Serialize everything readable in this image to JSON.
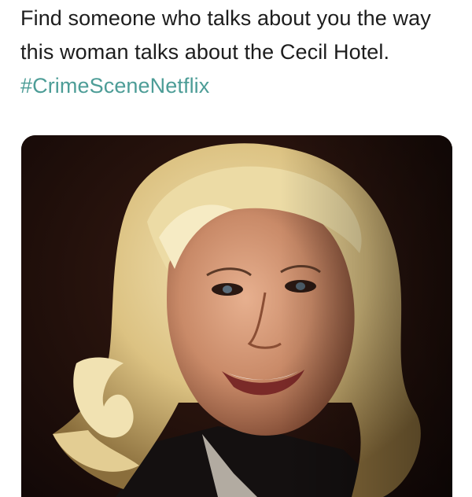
{
  "tweet": {
    "text": "Find someone who talks about you the way this woman talks about the Cecil Hotel.",
    "hashtag": "#CrimeSceneNetflix",
    "hashtag_color": "#4d9d97",
    "text_color": "#1d1d1d"
  },
  "media": {
    "image_type": "photo",
    "background_color": "#1c0d0a",
    "hair_color": "#e8d39a"
  }
}
